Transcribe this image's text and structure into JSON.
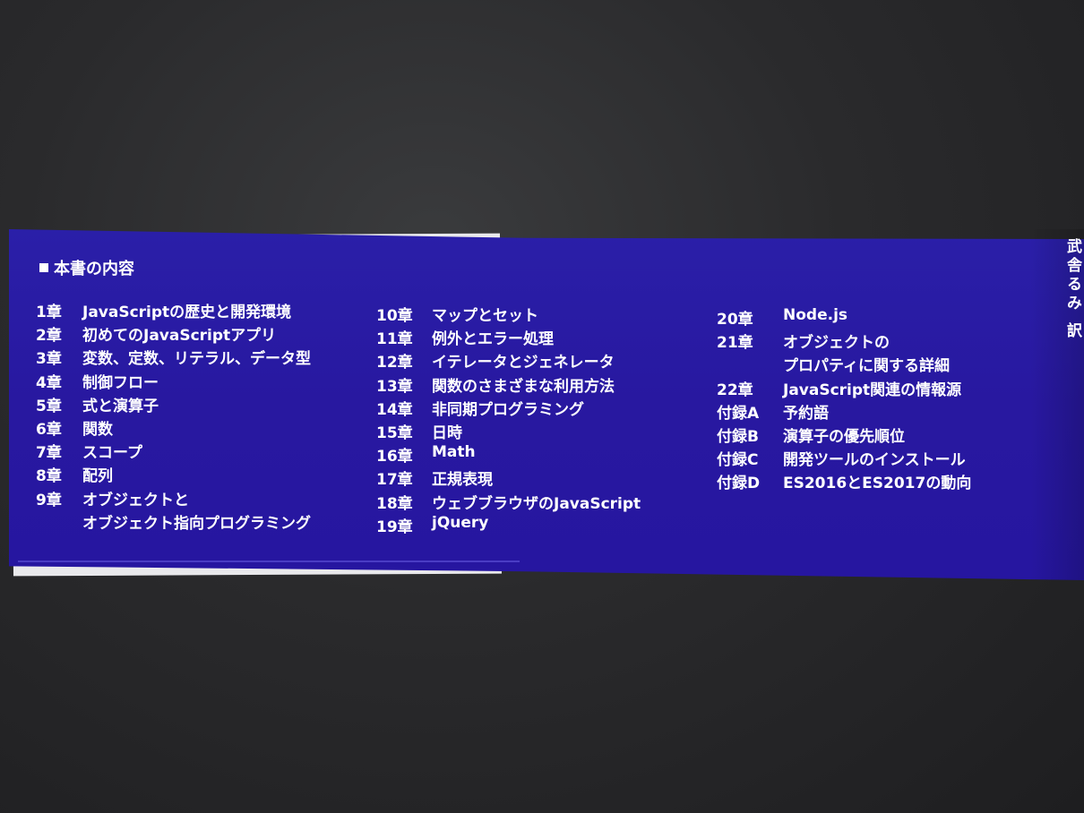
{
  "heading": "本書の内容",
  "columns": [
    [
      {
        "num": "1章",
        "title": "JavaScriptの歴史と開発環境"
      },
      {
        "num": "2章",
        "title": "初めてのJavaScriptアプリ"
      },
      {
        "num": "3章",
        "title": "変数、定数、リテラル、データ型"
      },
      {
        "num": "4章",
        "title": "制御フロー"
      },
      {
        "num": "5章",
        "title": "式と演算子"
      },
      {
        "num": "6章",
        "title": "関数"
      },
      {
        "num": "7章",
        "title": "スコープ"
      },
      {
        "num": "8章",
        "title": "配列"
      },
      {
        "num": "9章",
        "title": "オブジェクトと"
      },
      {
        "num": "",
        "title": "オブジェクト指向プログラミング"
      }
    ],
    [
      {
        "num": "10章",
        "title": "マップとセット"
      },
      {
        "num": "11章",
        "title": "例外とエラー処理"
      },
      {
        "num": "12章",
        "title": "イテレータとジェネレータ"
      },
      {
        "num": "13章",
        "title": "関数のさまざまな利用方法"
      },
      {
        "num": "14章",
        "title": "非同期プログラミング"
      },
      {
        "num": "15章",
        "title": "日時"
      },
      {
        "num": "16章",
        "title": "Math"
      },
      {
        "num": "17章",
        "title": "正規表現"
      },
      {
        "num": "18章",
        "title": "ウェブブラウザのJavaScript"
      },
      {
        "num": "19章",
        "title": "jQuery"
      }
    ],
    [
      {
        "num": "20章",
        "title": "Node.js"
      },
      {
        "num": "21章",
        "title": "オブジェクトの"
      },
      {
        "num": "",
        "title": "プロパティに関する詳細"
      },
      {
        "num": "22章",
        "title": "JavaScript関連の情報源"
      },
      {
        "num": "付録A",
        "title": "予約語"
      },
      {
        "num": "付録B",
        "title": "演算子の優先順位"
      },
      {
        "num": "付録C",
        "title": "開発ツールのインストール"
      },
      {
        "num": "付録D",
        "title": "ES2016とES2017の動向"
      }
    ]
  ],
  "spine_text": "武舎るみ 訳"
}
